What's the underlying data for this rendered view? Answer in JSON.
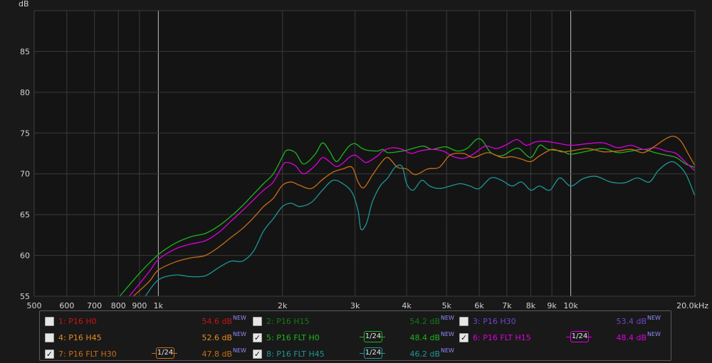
{
  "chart_data": {
    "type": "line",
    "ylabel": "dB",
    "xscale": "log",
    "xlim": [
      500,
      20000
    ],
    "ylim": [
      55,
      90
    ],
    "yticks": [
      55,
      60,
      65,
      70,
      75,
      80,
      85
    ],
    "xticks": [
      {
        "v": 500,
        "label": "500"
      },
      {
        "v": 600,
        "label": "600"
      },
      {
        "v": 700,
        "label": "700"
      },
      {
        "v": 800,
        "label": "800"
      },
      {
        "v": 900,
        "label": "900"
      },
      {
        "v": 1000,
        "label": "1k"
      },
      {
        "v": 2000,
        "label": "2k"
      },
      {
        "v": 3000,
        "label": "3k"
      },
      {
        "v": 4000,
        "label": "4k"
      },
      {
        "v": 5000,
        "label": "5k"
      },
      {
        "v": 6000,
        "label": "6k"
      },
      {
        "v": 7000,
        "label": "7k"
      },
      {
        "v": 8000,
        "label": "8k"
      },
      {
        "v": 9000,
        "label": "9k"
      },
      {
        "v": 10000,
        "label": "10k"
      },
      {
        "v": 20000,
        "label": "20.0kHz"
      }
    ],
    "major_gridlines": [
      1000,
      10000
    ],
    "grid": true,
    "series": [
      {
        "name": "5: P16 FLT H0",
        "color": "#1eb41e",
        "points": [
          [
            800,
            54.8
          ],
          [
            900,
            57.8
          ],
          [
            1000,
            60.1
          ],
          [
            1100,
            61.5
          ],
          [
            1200,
            62.3
          ],
          [
            1300,
            62.7
          ],
          [
            1400,
            63.6
          ],
          [
            1500,
            64.8
          ],
          [
            1600,
            66.1
          ],
          [
            1700,
            67.5
          ],
          [
            1800,
            68.8
          ],
          [
            1900,
            70.0
          ],
          [
            2000,
            72.1
          ],
          [
            2050,
            72.9
          ],
          [
            2150,
            72.6
          ],
          [
            2250,
            71.2
          ],
          [
            2400,
            72.4
          ],
          [
            2500,
            73.8
          ],
          [
            2600,
            72.8
          ],
          [
            2700,
            71.5
          ],
          [
            2800,
            72.4
          ],
          [
            2900,
            73.4
          ],
          [
            3000,
            73.7
          ],
          [
            3100,
            73.2
          ],
          [
            3200,
            72.9
          ],
          [
            3400,
            72.8
          ],
          [
            3500,
            73.0
          ],
          [
            3600,
            72.6
          ],
          [
            3800,
            72.7
          ],
          [
            4000,
            72.9
          ],
          [
            4200,
            73.2
          ],
          [
            4400,
            73.4
          ],
          [
            4600,
            73.0
          ],
          [
            4800,
            73.2
          ],
          [
            5000,
            73.3
          ],
          [
            5300,
            72.8
          ],
          [
            5600,
            73.1
          ],
          [
            5900,
            74.2
          ],
          [
            6100,
            74.1
          ],
          [
            6400,
            72.6
          ],
          [
            6800,
            72.2
          ],
          [
            7200,
            72.9
          ],
          [
            7500,
            73.1
          ],
          [
            8000,
            72.0
          ],
          [
            8400,
            73.5
          ],
          [
            8800,
            73.0
          ],
          [
            9500,
            72.8
          ],
          [
            10000,
            72.4
          ],
          [
            11000,
            72.8
          ],
          [
            12000,
            73.1
          ],
          [
            13000,
            72.6
          ],
          [
            14000,
            72.8
          ],
          [
            15000,
            73.0
          ],
          [
            16000,
            72.6
          ],
          [
            17000,
            72.3
          ],
          [
            18000,
            72.0
          ],
          [
            19000,
            71.2
          ],
          [
            20000,
            70.8
          ]
        ]
      },
      {
        "name": "6: P16 FLT H15",
        "color": "#dc00dc",
        "points": [
          [
            850,
            55.0
          ],
          [
            950,
            58.0
          ],
          [
            1000,
            59.5
          ],
          [
            1100,
            60.8
          ],
          [
            1200,
            61.4
          ],
          [
            1300,
            61.8
          ],
          [
            1400,
            62.8
          ],
          [
            1500,
            64.2
          ],
          [
            1600,
            65.5
          ],
          [
            1700,
            66.8
          ],
          [
            1800,
            68.0
          ],
          [
            1900,
            69.0
          ],
          [
            2000,
            71.0
          ],
          [
            2050,
            71.4
          ],
          [
            2150,
            71.0
          ],
          [
            2250,
            70.0
          ],
          [
            2400,
            71.0
          ],
          [
            2500,
            72.0
          ],
          [
            2600,
            71.5
          ],
          [
            2700,
            70.9
          ],
          [
            2800,
            71.3
          ],
          [
            2900,
            72.0
          ],
          [
            3000,
            72.3
          ],
          [
            3100,
            71.8
          ],
          [
            3200,
            71.4
          ],
          [
            3400,
            72.2
          ],
          [
            3500,
            72.8
          ],
          [
            3700,
            73.2
          ],
          [
            3900,
            73.0
          ],
          [
            4100,
            72.5
          ],
          [
            4300,
            72.8
          ],
          [
            4600,
            73.0
          ],
          [
            4900,
            72.8
          ],
          [
            5200,
            72.1
          ],
          [
            5500,
            71.9
          ],
          [
            5800,
            72.4
          ],
          [
            6200,
            73.4
          ],
          [
            6600,
            73.1
          ],
          [
            7000,
            73.6
          ],
          [
            7400,
            74.2
          ],
          [
            7800,
            73.5
          ],
          [
            8200,
            73.9
          ],
          [
            8600,
            74.0
          ],
          [
            9200,
            73.8
          ],
          [
            10000,
            73.5
          ],
          [
            11000,
            73.7
          ],
          [
            12000,
            73.8
          ],
          [
            13000,
            73.2
          ],
          [
            14000,
            73.5
          ],
          [
            15000,
            73.0
          ],
          [
            16000,
            73.2
          ],
          [
            17000,
            72.8
          ],
          [
            18000,
            72.5
          ],
          [
            19000,
            71.4
          ],
          [
            20000,
            70.4
          ]
        ]
      },
      {
        "name": "7: P16 FLT H30",
        "color": "#c86e14",
        "points": [
          [
            870,
            55.0
          ],
          [
            950,
            56.8
          ],
          [
            1000,
            58.2
          ],
          [
            1100,
            59.2
          ],
          [
            1200,
            59.7
          ],
          [
            1300,
            60.0
          ],
          [
            1400,
            61.0
          ],
          [
            1500,
            62.2
          ],
          [
            1600,
            63.3
          ],
          [
            1700,
            64.6
          ],
          [
            1800,
            66.0
          ],
          [
            1900,
            67.0
          ],
          [
            2000,
            68.6
          ],
          [
            2100,
            69.0
          ],
          [
            2200,
            68.6
          ],
          [
            2350,
            68.2
          ],
          [
            2500,
            69.3
          ],
          [
            2650,
            70.2
          ],
          [
            2800,
            70.6
          ],
          [
            2950,
            70.8
          ],
          [
            3050,
            69.0
          ],
          [
            3150,
            68.3
          ],
          [
            3300,
            69.8
          ],
          [
            3450,
            71.2
          ],
          [
            3600,
            72.0
          ],
          [
            3800,
            70.8
          ],
          [
            4000,
            70.6
          ],
          [
            4200,
            69.9
          ],
          [
            4500,
            70.6
          ],
          [
            4800,
            70.8
          ],
          [
            5100,
            72.3
          ],
          [
            5500,
            72.5
          ],
          [
            5800,
            72.0
          ],
          [
            6300,
            72.6
          ],
          [
            6800,
            72.0
          ],
          [
            7200,
            72.1
          ],
          [
            7600,
            71.8
          ],
          [
            8000,
            71.5
          ],
          [
            8400,
            72.2
          ],
          [
            9000,
            73.0
          ],
          [
            9500,
            72.7
          ],
          [
            10000,
            72.8
          ],
          [
            11000,
            73.1
          ],
          [
            12000,
            72.7
          ],
          [
            13000,
            72.8
          ],
          [
            14000,
            73.0
          ],
          [
            15000,
            72.6
          ],
          [
            16000,
            73.4
          ],
          [
            17000,
            74.3
          ],
          [
            17800,
            74.6
          ],
          [
            18500,
            74.0
          ],
          [
            19200,
            72.6
          ],
          [
            20000,
            71.0
          ]
        ]
      },
      {
        "name": "8: P16 FLT H45",
        "color": "#1e9696",
        "points": [
          [
            930,
            55.0
          ],
          [
            1000,
            57.0
          ],
          [
            1100,
            57.6
          ],
          [
            1200,
            57.4
          ],
          [
            1300,
            57.5
          ],
          [
            1400,
            58.5
          ],
          [
            1500,
            59.3
          ],
          [
            1600,
            59.3
          ],
          [
            1700,
            60.5
          ],
          [
            1800,
            63.0
          ],
          [
            1900,
            64.5
          ],
          [
            2000,
            66.0
          ],
          [
            2100,
            66.4
          ],
          [
            2200,
            66.0
          ],
          [
            2350,
            66.5
          ],
          [
            2500,
            68.0
          ],
          [
            2650,
            69.2
          ],
          [
            2800,
            68.8
          ],
          [
            2950,
            67.7
          ],
          [
            3050,
            65.5
          ],
          [
            3100,
            63.2
          ],
          [
            3200,
            64.0
          ],
          [
            3300,
            66.5
          ],
          [
            3450,
            68.5
          ],
          [
            3600,
            69.5
          ],
          [
            3750,
            70.8
          ],
          [
            3900,
            70.9
          ],
          [
            4000,
            68.8
          ],
          [
            4150,
            68.0
          ],
          [
            4350,
            69.2
          ],
          [
            4550,
            68.5
          ],
          [
            4800,
            68.2
          ],
          [
            5100,
            68.5
          ],
          [
            5400,
            68.8
          ],
          [
            5700,
            68.5
          ],
          [
            6000,
            68.2
          ],
          [
            6400,
            69.5
          ],
          [
            6800,
            69.2
          ],
          [
            7200,
            68.5
          ],
          [
            7600,
            69.0
          ],
          [
            8000,
            68.0
          ],
          [
            8400,
            68.5
          ],
          [
            8900,
            68.0
          ],
          [
            9400,
            69.5
          ],
          [
            10000,
            68.5
          ],
          [
            10700,
            69.4
          ],
          [
            11500,
            69.7
          ],
          [
            12500,
            69.0
          ],
          [
            13500,
            68.9
          ],
          [
            14500,
            69.5
          ],
          [
            15500,
            69.0
          ],
          [
            16300,
            70.4
          ],
          [
            17300,
            71.4
          ],
          [
            18000,
            71.3
          ],
          [
            19000,
            70.0
          ],
          [
            20000,
            67.3
          ]
        ]
      }
    ]
  },
  "legend": [
    {
      "name": "1: P16 H0",
      "color": "#c81414",
      "checked": false,
      "level": "54.6 dB",
      "smoothing": ""
    },
    {
      "name": "2: P16 H15",
      "color": "#147814",
      "checked": false,
      "level": "54.2 dB",
      "smoothing": ""
    },
    {
      "name": "3: P16 H30",
      "color": "#6e46c8",
      "checked": false,
      "level": "53.4 dB",
      "smoothing": ""
    },
    {
      "name": "4: P16 H45",
      "color": "#e68c1e",
      "checked": false,
      "level": "52.6 dB",
      "smoothing": ""
    },
    {
      "name": "5: P16 FLT H0",
      "color": "#1eb41e",
      "checked": true,
      "level": "48.4 dB",
      "smoothing": "1/24"
    },
    {
      "name": "6: P16 FLT H15",
      "color": "#dc00dc",
      "checked": true,
      "level": "48.4 dB",
      "smoothing": "1/24"
    },
    {
      "name": "7: P16 FLT H30",
      "color": "#c86e14",
      "checked": true,
      "level": "47.8 dB",
      "smoothing": "1/24"
    },
    {
      "name": "8: P16 FLT H45",
      "color": "#1e9696",
      "checked": true,
      "level": "46.2 dB",
      "smoothing": "1/24"
    }
  ],
  "legend_new_badge": "NEW",
  "check_mark": "✓"
}
